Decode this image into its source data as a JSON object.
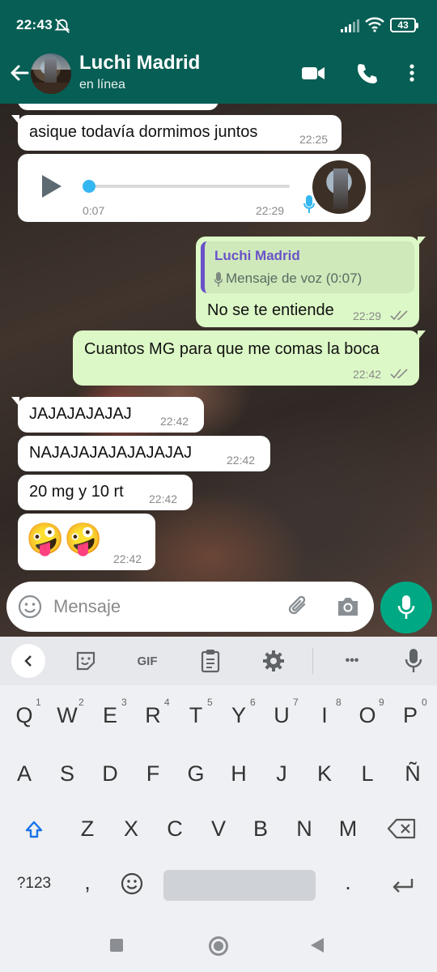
{
  "status_bar": {
    "time": "22:43",
    "battery": "43"
  },
  "header": {
    "contact_name": "Luchi Madrid",
    "presence": "en línea"
  },
  "messages": [
    {
      "type": "text",
      "dir": "in",
      "text": "asique todavía dormimos juntos",
      "time": "22:25"
    },
    {
      "type": "voice",
      "dir": "in",
      "duration": "0:07",
      "time": "22:29",
      "progress": 0
    },
    {
      "type": "reply",
      "dir": "out",
      "quote_author": "Luchi Madrid",
      "quote_text": "Mensaje de voz (0:07)",
      "text": "No se te entiende",
      "time": "22:29"
    },
    {
      "type": "text",
      "dir": "out",
      "text": "Cuantos MG para que me comas la boca",
      "time": "22:42"
    },
    {
      "type": "text",
      "dir": "in",
      "text": "JAJAJAJAJAJ",
      "time": "22:42"
    },
    {
      "type": "text",
      "dir": "in",
      "text": "NAJAJAJAJAJAJAJAJ",
      "time": "22:42"
    },
    {
      "type": "text",
      "dir": "in",
      "text": "20 mg y 10 rt",
      "time": "22:42"
    },
    {
      "type": "emoji",
      "dir": "in",
      "text": "🤪🤪",
      "time": "22:42"
    }
  ],
  "composer": {
    "placeholder": "Mensaje"
  },
  "keyboard": {
    "toolbar": {
      "gif": "GIF",
      "more": "•••"
    },
    "row1": [
      "Q",
      "W",
      "E",
      "R",
      "T",
      "Y",
      "U",
      "I",
      "O",
      "P"
    ],
    "row1_hints": [
      "1",
      "2",
      "3",
      "4",
      "5",
      "6",
      "7",
      "8",
      "9",
      "0"
    ],
    "row2": [
      "A",
      "S",
      "D",
      "F",
      "G",
      "H",
      "J",
      "K",
      "L",
      "Ñ"
    ],
    "row3": [
      "Z",
      "X",
      "C",
      "V",
      "B",
      "N",
      "M"
    ],
    "row4": {
      "symbols": "?123",
      "comma": ",",
      "period": "."
    }
  },
  "colors": {
    "header": "#075e54",
    "outgoing": "#dcf8c6",
    "incoming": "#ffffff",
    "accent": "#00a884",
    "quote_accent": "#6a52c8"
  },
  "icons": [
    "back-arrow-icon",
    "video-call-icon",
    "phone-icon",
    "more-vert-icon",
    "play-icon",
    "mic-icon",
    "double-check-icon",
    "emoji-icon",
    "attach-icon",
    "camera-icon"
  ]
}
